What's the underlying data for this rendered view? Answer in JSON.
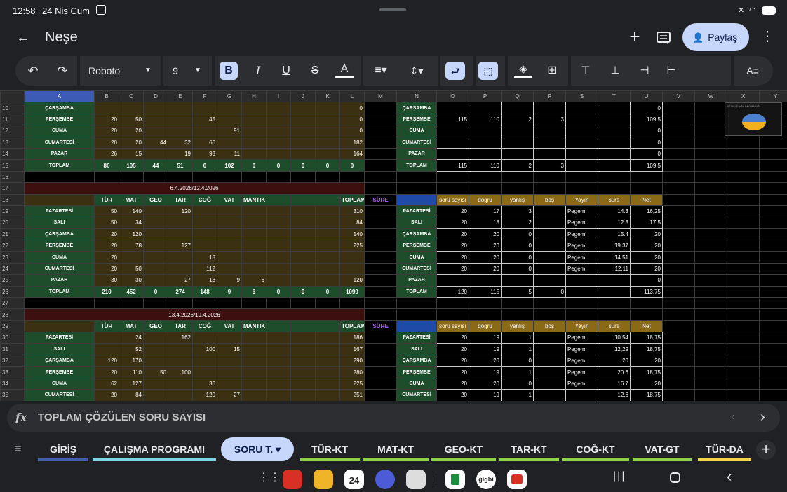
{
  "status_bar": {
    "time": "12:58",
    "date": "24 Nis Cum"
  },
  "appbar": {
    "title": "Neşe",
    "share_label": "Paylaş"
  },
  "toolbar": {
    "font": "Roboto",
    "font_size": "9"
  },
  "formula": {
    "fx": "fx",
    "text": "TOPLAM ÇÖZÜLEN SORU SAYISI"
  },
  "columns": [
    "A",
    "B",
    "C",
    "D",
    "E",
    "F",
    "G",
    "H",
    "I",
    "J",
    "K",
    "L",
    "M",
    "N",
    "O",
    "P",
    "Q",
    "R",
    "S",
    "T",
    "U",
    "V",
    "W",
    "X",
    "Y"
  ],
  "rows": [
    {
      "n": "10",
      "cells": [
        "ÇARŞAMBA",
        "",
        "",
        "",
        "",
        "",
        "",
        "",
        "",
        "",
        "",
        "0",
        "",
        "ÇARŞAMBA",
        "",
        "",
        "",
        "",
        "",
        "",
        "0",
        "",
        "",
        "",
        ""
      ]
    },
    {
      "n": "11",
      "cells": [
        "PERŞEMBE",
        "20",
        "50",
        "",
        "",
        "45",
        "",
        "",
        "",
        "",
        "",
        "0",
        "",
        "PERŞEMBE",
        "115",
        "110",
        "2",
        "3",
        "",
        "",
        "109,5",
        "",
        "",
        "",
        ""
      ]
    },
    {
      "n": "12",
      "cells": [
        "CUMA",
        "20",
        "20",
        "",
        "",
        "",
        "91",
        "",
        "",
        "",
        "",
        "0",
        "",
        "CUMA",
        "",
        "",
        "",
        "",
        "",
        "",
        "0",
        "",
        "",
        "",
        ""
      ]
    },
    {
      "n": "13",
      "cells": [
        "CUMARTESİ",
        "20",
        "20",
        "44",
        "32",
        "66",
        "",
        "",
        "",
        "",
        "",
        "182",
        "",
        "CUMARTESİ",
        "",
        "",
        "",
        "",
        "",
        "",
        "0",
        "",
        "",
        "",
        ""
      ]
    },
    {
      "n": "14",
      "cells": [
        "PAZAR",
        "26",
        "15",
        "",
        "19",
        "93",
        "11",
        "",
        "",
        "",
        "",
        "164",
        "",
        "PAZAR",
        "",
        "",
        "",
        "",
        "",
        "",
        "0",
        "",
        "",
        "",
        ""
      ]
    },
    {
      "n": "15",
      "cells": [
        "TOPLAM",
        "86",
        "105",
        "44",
        "51",
        "0",
        "102",
        "0",
        "0",
        "0",
        "0",
        "0",
        "",
        "TOPLAM",
        "115",
        "110",
        "2",
        "3",
        "",
        "",
        "109,5",
        "",
        "",
        "",
        ""
      ]
    },
    {
      "n": "16",
      "cells": [
        "",
        "",
        "",
        "",
        "",
        "",
        "",
        "",
        "",
        "",
        "",
        "",
        "",
        "",
        "",
        "",
        "",
        "",
        "",
        "",
        "",
        "",
        "",
        "",
        ""
      ]
    },
    {
      "n": "17",
      "cells": [
        "6.4.2026/12.4.2026",
        "",
        "",
        "",
        "",
        "",
        "",
        "",
        "",
        "",
        "",
        "",
        "",
        "",
        "",
        "",
        "",
        "",
        "",
        "",
        "",
        "",
        "",
        "",
        ""
      ]
    },
    {
      "n": "18",
      "cells": [
        "",
        "TÜR",
        "MAT",
        "GEO",
        "TAR",
        "COĞ",
        "VAT",
        "MANTIK",
        "",
        "",
        "",
        "TOPLAM",
        "SÜRE",
        "",
        "soru sayısı",
        "doğru",
        "yanlış",
        "boş",
        "Yayın",
        "süre",
        "Net",
        "",
        "",
        "",
        ""
      ]
    },
    {
      "n": "19",
      "cells": [
        "PAZARTESİ",
        "50",
        "140",
        "",
        "120",
        "",
        "",
        "",
        "",
        "",
        "",
        "310",
        "",
        "PAZARTESİ",
        "20",
        "17",
        "3",
        "",
        "Pegem",
        "14.3",
        "16,25",
        "",
        "",
        "",
        ""
      ]
    },
    {
      "n": "20",
      "cells": [
        "SALI",
        "50",
        "34",
        "",
        "",
        "",
        "",
        "",
        "",
        "",
        "",
        "84",
        "",
        "SALI",
        "20",
        "18",
        "2",
        "",
        "Pegem",
        "12.3",
        "17,5",
        "",
        "",
        "",
        ""
      ]
    },
    {
      "n": "21",
      "cells": [
        "ÇARŞAMBA",
        "20",
        "120",
        "",
        "",
        "",
        "",
        "",
        "",
        "",
        "",
        "140",
        "",
        "ÇARŞAMBA",
        "20",
        "20",
        "0",
        "",
        "Pegem",
        "15.4",
        "20",
        "",
        "",
        "",
        ""
      ]
    },
    {
      "n": "22",
      "cells": [
        "PERŞEMBE",
        "20",
        "78",
        "",
        "127",
        "",
        "",
        "",
        "",
        "",
        "",
        "225",
        "",
        "PERŞEMBE",
        "20",
        "20",
        "0",
        "",
        "Pegem",
        "19.37",
        "20",
        "",
        "",
        "",
        ""
      ]
    },
    {
      "n": "23",
      "cells": [
        "CUMA",
        "20",
        "",
        "",
        "",
        "18",
        "",
        "",
        "",
        "",
        "",
        "",
        "",
        "CUMA",
        "20",
        "20",
        "0",
        "",
        "Pegem",
        "14.51",
        "20",
        "",
        "",
        "",
        ""
      ]
    },
    {
      "n": "24",
      "cells": [
        "CUMARTESİ",
        "20",
        "50",
        "",
        "",
        "112",
        "",
        "",
        "",
        "",
        "",
        "",
        "",
        "CUMARTESİ",
        "20",
        "20",
        "0",
        "",
        "Pegem",
        "12.11",
        "20",
        "",
        "",
        "",
        ""
      ]
    },
    {
      "n": "25",
      "cells": [
        "PAZAR",
        "30",
        "30",
        "",
        "27",
        "18",
        "9",
        "6",
        "",
        "",
        "",
        "120",
        "",
        "PAZAR",
        "",
        "",
        "",
        "",
        "",
        "",
        "0",
        "",
        "",
        "",
        ""
      ]
    },
    {
      "n": "26",
      "cells": [
        "TOPLAM",
        "210",
        "452",
        "0",
        "274",
        "148",
        "9",
        "6",
        "0",
        "0",
        "0",
        "1099",
        "",
        "TOPLAM",
        "120",
        "115",
        "5",
        "0",
        "",
        "",
        "113,75",
        "",
        "",
        "",
        ""
      ]
    },
    {
      "n": "27",
      "cells": [
        "",
        "",
        "",
        "",
        "",
        "",
        "",
        "",
        "",
        "",
        "",
        "",
        "",
        "",
        "",
        "",
        "",
        "",
        "",
        "",
        "",
        "",
        "",
        "",
        ""
      ]
    },
    {
      "n": "28",
      "cells": [
        "13.4.2026/19.4.2026",
        "",
        "",
        "",
        "",
        "",
        "",
        "",
        "",
        "",
        "",
        "",
        "",
        "",
        "",
        "",
        "",
        "",
        "",
        "",
        "",
        "",
        "",
        "",
        ""
      ]
    },
    {
      "n": "29",
      "cells": [
        "",
        "TÜR",
        "MAT",
        "GEO",
        "TAR",
        "COĞ",
        "VAT",
        "MANTIK",
        "",
        "",
        "",
        "TOPLAM",
        "SÜRE",
        "",
        "soru sayısı",
        "doğru",
        "yanlış",
        "boş",
        "Yayın",
        "süre",
        "Net",
        "",
        "",
        "",
        ""
      ]
    },
    {
      "n": "30",
      "cells": [
        "PAZARTESİ",
        "",
        "24",
        "",
        "162",
        "",
        "",
        "",
        "",
        "",
        "",
        "186",
        "",
        "PAZARTESİ",
        "20",
        "19",
        "1",
        "",
        "Pegem",
        "10.54",
        "18,75",
        "",
        "",
        "",
        ""
      ]
    },
    {
      "n": "31",
      "cells": [
        "SALI",
        "",
        "52",
        "",
        "",
        "100",
        "15",
        "",
        "",
        "",
        "",
        "167",
        "",
        "SALI",
        "20",
        "19",
        "1",
        "",
        "Pegem",
        "12,29",
        "18,75",
        "",
        "",
        "",
        ""
      ]
    },
    {
      "n": "32",
      "cells": [
        "ÇARŞAMBA",
        "120",
        "170",
        "",
        "",
        "",
        "",
        "",
        "",
        "",
        "",
        "290",
        "",
        "ÇARŞAMBA",
        "20",
        "20",
        "0",
        "",
        "Pegem",
        "20",
        "20",
        "",
        "",
        "",
        ""
      ]
    },
    {
      "n": "33",
      "cells": [
        "PERŞEMBE",
        "20",
        "110",
        "50",
        "100",
        "",
        "",
        "",
        "",
        "",
        "",
        "280",
        "",
        "PERŞEMBE",
        "20",
        "19",
        "1",
        "",
        "Pegem",
        "20.6",
        "18,75",
        "",
        "",
        "",
        ""
      ]
    },
    {
      "n": "34",
      "cells": [
        "CUMA",
        "62",
        "127",
        "",
        "",
        "36",
        "",
        "",
        "",
        "",
        "",
        "225",
        "",
        "CUMA",
        "20",
        "20",
        "0",
        "",
        "Pegem",
        "16.7",
        "20",
        "",
        "",
        "",
        ""
      ]
    },
    {
      "n": "35",
      "cells": [
        "CUMARTESİ",
        "20",
        "84",
        "",
        "",
        "120",
        "27",
        "",
        "",
        "",
        "",
        "251",
        "",
        "CUMARTESİ",
        "20",
        "19",
        "1",
        "",
        "",
        "12.6",
        "18,75",
        "",
        "",
        "",
        ""
      ]
    }
  ],
  "embedded_chart": {
    "title": "SORU DAĞILIM GRAFİĞİ"
  },
  "tabs": [
    {
      "label": "GİRİŞ",
      "color": "#3f5fa8"
    },
    {
      "label": "ÇALIŞMA PROGRAMI",
      "color": "#7fd3e6"
    },
    {
      "label": "SORU T.",
      "color": "#c7d7fc"
    },
    {
      "label": "TÜR-KT",
      "color": "#8bd44b"
    },
    {
      "label": "MAT-KT",
      "color": "#8bd44b"
    },
    {
      "label": "GEO-KT",
      "color": "#8bd44b"
    },
    {
      "label": "TAR-KT",
      "color": "#8bd44b"
    },
    {
      "label": "COĞ-KT",
      "color": "#8bd44b"
    },
    {
      "label": "VAT-GT",
      "color": "#8bd44b"
    },
    {
      "label": "TÜR-DA",
      "color": "#f6d34a"
    }
  ],
  "dock": {
    "calendar_day": "24",
    "app_label": "gigbi"
  }
}
